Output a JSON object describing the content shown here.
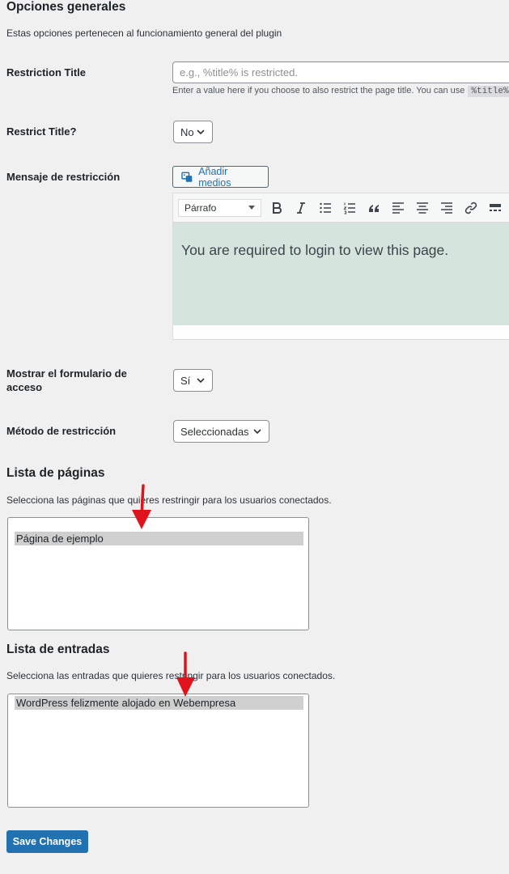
{
  "section_general": {
    "title": "Opciones generales",
    "description": "Estas opciones pertenecen al funcionamiento general del plugin"
  },
  "restriction_title": {
    "label": "Restriction Title",
    "placeholder": "e.g., %title% is restricted.",
    "hint": "Enter a value here if you choose to also restrict the page title. You can use",
    "hint_code": "%title%"
  },
  "restrict_title": {
    "label": "Restrict Title?",
    "value": "No"
  },
  "message": {
    "label": "Mensaje de restricción",
    "add_media": "Añadir medios",
    "format": "Párrafo",
    "content": "You are required to login to view this page.",
    "toolbar_icons": [
      "bold-icon",
      "italic-icon",
      "bulleted-list-icon",
      "numbered-list-icon",
      "blockquote-icon",
      "align-left-icon",
      "align-center-icon",
      "align-right-icon",
      "link-icon",
      "toolbar-toggle-icon"
    ]
  },
  "show_login": {
    "label": "Mostrar el formulario de acceso",
    "value": "Sí"
  },
  "method": {
    "label": "Método de restricción",
    "value": "Seleccionadas"
  },
  "pages": {
    "title": "Lista de páginas",
    "description": "Selecciona las páginas que quieres restringir para los usuarios conectados.",
    "selected_item": "Página de ejemplo"
  },
  "posts": {
    "title": "Lista de entradas",
    "description": "Selecciona las entradas que quieres restringir para los usuarios conectados.",
    "selected_item": "WordPress felizmente alojado en Webempresa"
  },
  "save_label": "Save Changes",
  "colors": {
    "accent": "#2271b1",
    "arrow": "#e0121b",
    "editor_bg": "#d5e5de"
  }
}
